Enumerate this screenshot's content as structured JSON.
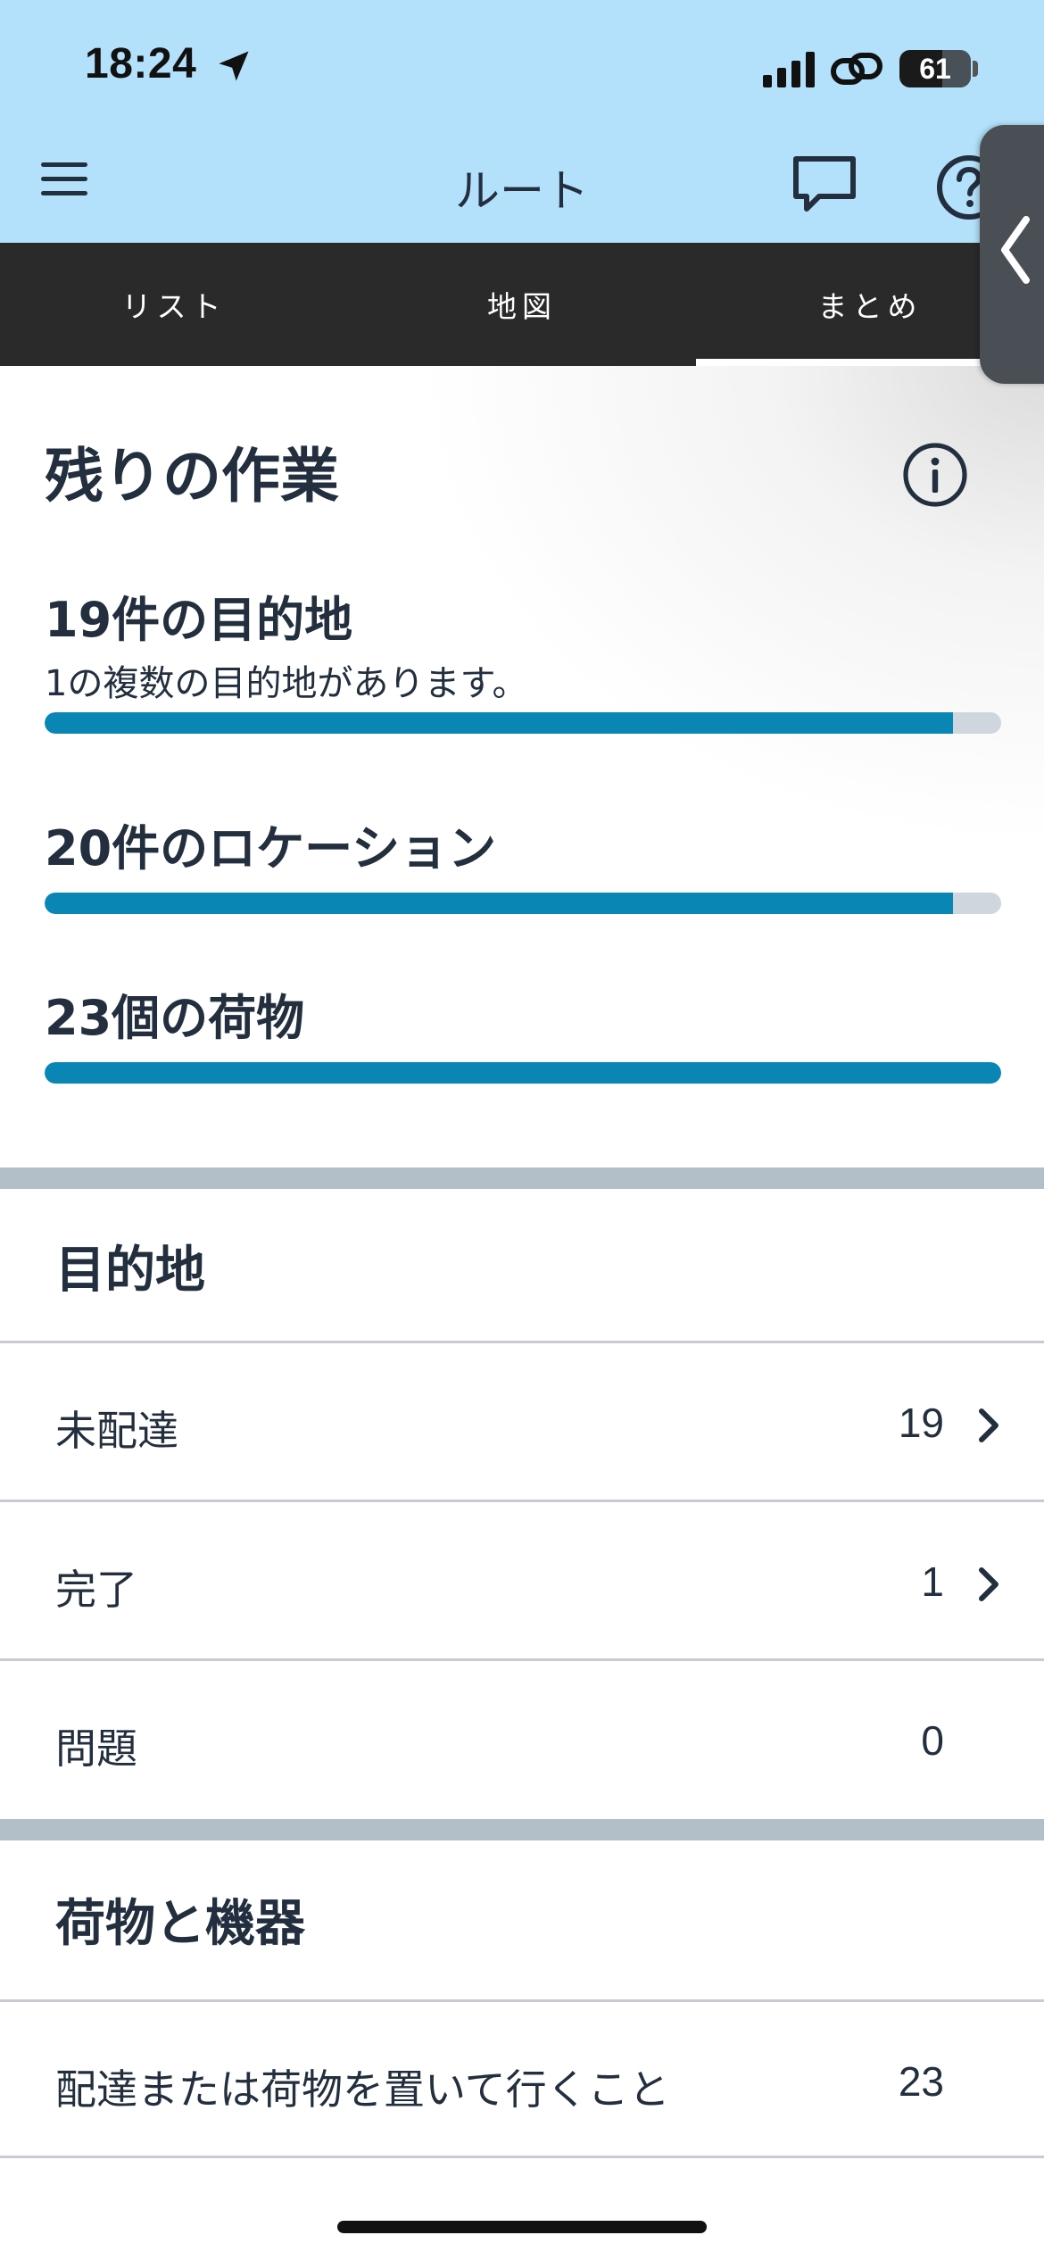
{
  "status_bar": {
    "time": "18:24",
    "battery": "61",
    "icons": [
      "location-arrow-icon",
      "signal-icon",
      "link-icon",
      "battery-icon"
    ]
  },
  "header": {
    "title": "ルート",
    "icons": [
      "hamburger-menu-icon",
      "chat-bubble-icon",
      "help-icon"
    ]
  },
  "tabs": [
    {
      "label": "リスト",
      "active": false
    },
    {
      "label": "地図",
      "active": false
    },
    {
      "label": "まとめ",
      "active": true
    }
  ],
  "remaining_work": {
    "heading": "残りの作業",
    "metrics": [
      {
        "title": "19件の目的地",
        "subtitle": "1の複数の目的地があります。",
        "progress": 0.95
      },
      {
        "title": "20件のロケーション",
        "subtitle": "",
        "progress": 0.95
      },
      {
        "title": "23個の荷物",
        "subtitle": "",
        "progress": 1.0
      }
    ]
  },
  "destinations": {
    "heading": "目的地",
    "rows": [
      {
        "label": "未配達",
        "count": "19",
        "has_chevron": true
      },
      {
        "label": "完了",
        "count": "1",
        "has_chevron": true
      },
      {
        "label": "問題",
        "count": "0",
        "has_chevron": false
      }
    ]
  },
  "packages": {
    "heading": "荷物と機器",
    "rows": [
      {
        "label": "配達または荷物を置いて行くこと",
        "count": "23",
        "has_chevron": false
      }
    ]
  },
  "colors": {
    "header_bg": "#b3e0fa",
    "tab_bar_bg": "#2a2a2a",
    "progress_fill": "#0a86b5",
    "progress_track": "#cfd6de",
    "text": "#232f3e",
    "divider_band": "#b3bfc8"
  }
}
